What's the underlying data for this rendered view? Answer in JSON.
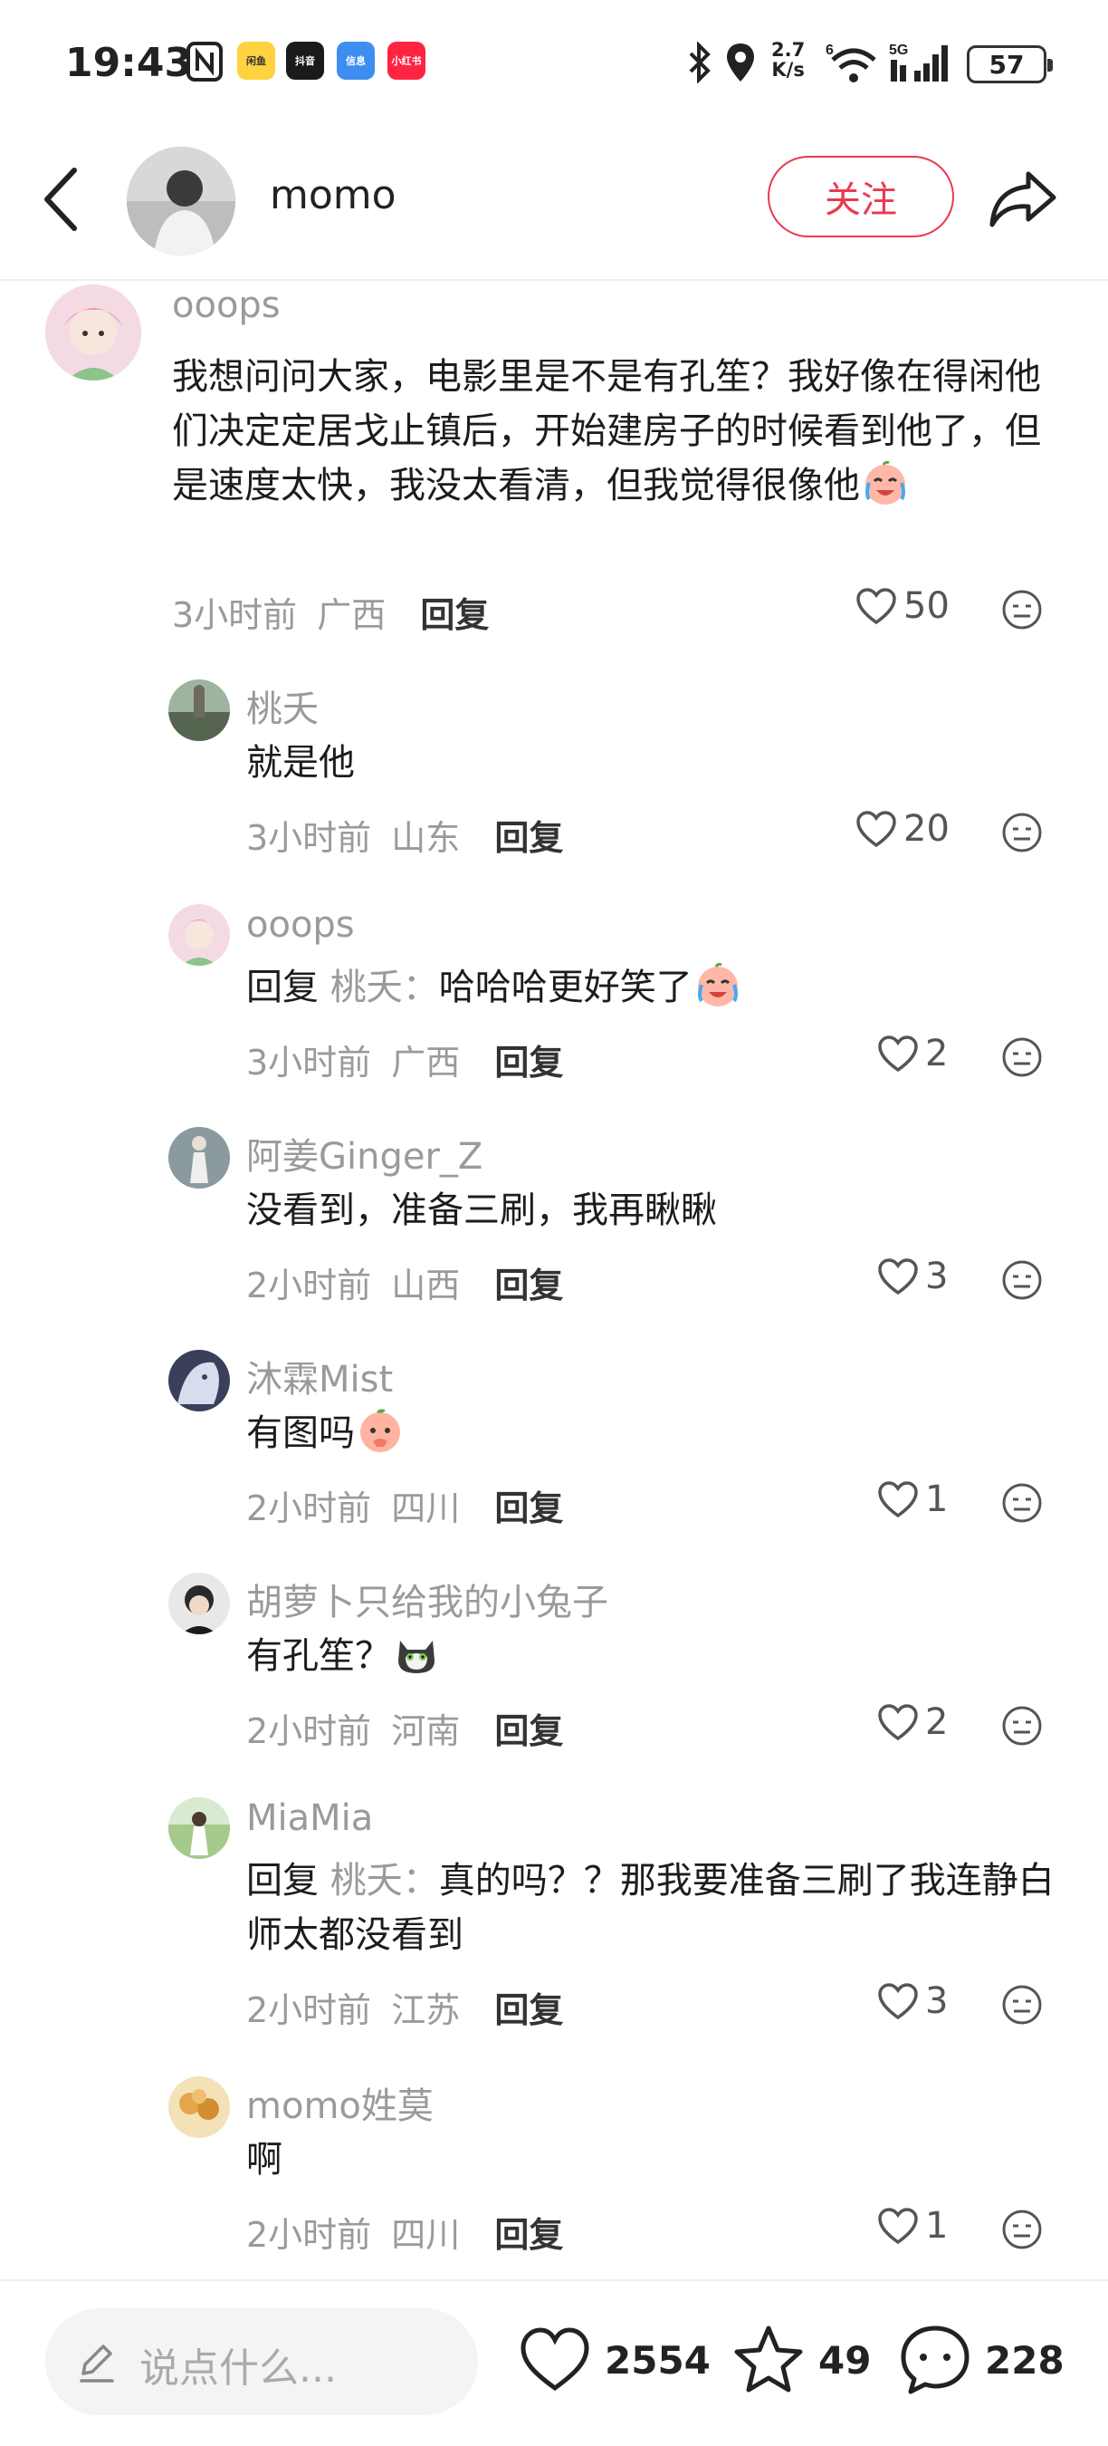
{
  "status_bar": {
    "time": "19:43",
    "apps": [
      {
        "name": "app-icon-1",
        "label": "闲鱼",
        "color": "#ffd23f"
      },
      {
        "name": "app-icon-2",
        "label": "抖音",
        "color": "#1a1a1a"
      },
      {
        "name": "app-icon-3",
        "label": "信息",
        "color": "#3d8ef0"
      },
      {
        "name": "app-icon-4",
        "label": "小红书",
        "color": "#ff2442"
      }
    ],
    "net_speed_value": "2.7",
    "net_speed_unit": "K/s",
    "battery": "57"
  },
  "header": {
    "author_name": "momo",
    "follow_label": "关注"
  },
  "comments": [
    {
      "name": "ooops",
      "text": "我想问问大家，电影里是不是有孔笙？我好像在得闲他们决定定居戈止镇后，开始建房子的时候看到他了，但是速度太快，我没太看清，但我觉得很像他",
      "time": "3小时前",
      "location": "广西",
      "reply_label": "回复",
      "likes": "50"
    },
    {
      "name": "桃夭",
      "text": "就是他",
      "time": "3小时前",
      "location": "山东",
      "reply_label": "回复",
      "likes": "20"
    },
    {
      "name": "ooops",
      "reply_prefix": "回复",
      "reply_target": "桃夭：",
      "text": "哈哈哈更好笑了",
      "time": "3小时前",
      "location": "广西",
      "reply_label": "回复",
      "likes": "2"
    },
    {
      "name": "阿姜Ginger_Z",
      "text": "没看到，准备三刷，我再瞅瞅",
      "time": "2小时前",
      "location": "山西",
      "reply_label": "回复",
      "likes": "3"
    },
    {
      "name": "沐霖Mist",
      "text": "有图吗",
      "time": "2小时前",
      "location": "四川",
      "reply_label": "回复",
      "likes": "1"
    },
    {
      "name": "胡萝卜只给我的小兔子",
      "text": "有孔笙？",
      "time": "2小时前",
      "location": "河南",
      "reply_label": "回复",
      "likes": "2"
    },
    {
      "name": "MiaMia",
      "reply_prefix": "回复",
      "reply_target": "桃夭：",
      "text": "真的吗？？那我要准备三刷了我连静白师太都没看到",
      "time": "2小时前",
      "location": "江苏",
      "reply_label": "回复",
      "likes": "3"
    },
    {
      "name": "momo姓莫",
      "text": "啊",
      "time": "2小时前",
      "location": "四川",
      "reply_label": "回复",
      "likes": "1"
    }
  ],
  "bottom_bar": {
    "input_placeholder": "说点什么...",
    "like_count": "2554",
    "collect_count": "49",
    "comment_count": "228"
  },
  "colors": {
    "accent": "#e83a4f",
    "muted_text": "#9a9a9a",
    "body_text": "#1c1c1c"
  }
}
